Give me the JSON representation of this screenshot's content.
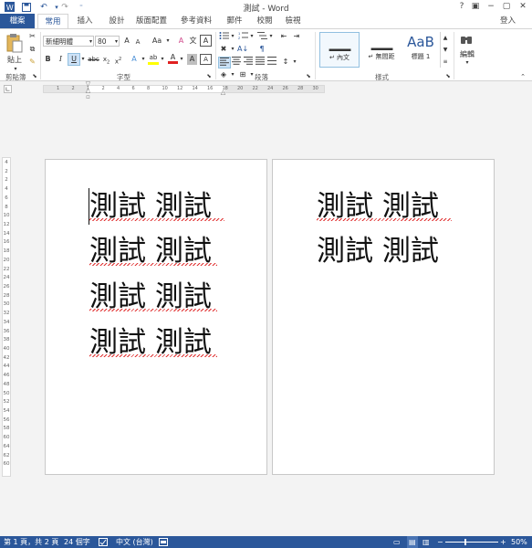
{
  "app": {
    "title": "測試 - Word",
    "login": "登入",
    "window_buttons": [
      "?",
      "▣",
      "−",
      "▢",
      "✕"
    ]
  },
  "tabs": [
    "檔案",
    "常用",
    "插入",
    "設計",
    "版面配置",
    "參考資料",
    "郵件",
    "校閱",
    "檢視"
  ],
  "ribbon": {
    "clipboard": {
      "paste_label": "貼上",
      "group_label": "剪貼簿"
    },
    "font": {
      "font_name": "新細明體",
      "font_size": "80",
      "grow": "A",
      "shrink": "A",
      "change_case": "Aa",
      "bold": "B",
      "italic": "I",
      "underline": "U",
      "strike": "abc",
      "subscript": "x",
      "superscript": "x",
      "text_effect": "A",
      "highlight": "ab",
      "font_color": "A",
      "char_shading": "A",
      "group_label": "字型"
    },
    "paragraph": {
      "group_label": "段落"
    },
    "styles": {
      "items": [
        {
          "preview": "▁▁",
          "label": "↵ 內文"
        },
        {
          "preview": "▁▁",
          "label": "↵ 無間距"
        },
        {
          "preview": "AaB",
          "label": "標題 1"
        }
      ],
      "group_label": "樣式"
    },
    "editing": {
      "label": "編輯"
    }
  },
  "document": {
    "page1_lines": [
      "測試 測試",
      "測試 測試",
      "測試 測試",
      "測試 測試"
    ],
    "page2_lines": [
      "測試 測試",
      "測試 測試"
    ]
  },
  "ruler": {
    "h_ticks": [
      "1",
      "2",
      "1",
      "2",
      "4",
      "6",
      "8",
      "10",
      "12",
      "14",
      "16",
      "18",
      "20",
      "22",
      "24",
      "26",
      "28",
      "30"
    ],
    "v_ticks": [
      "4",
      "2",
      "2",
      "4",
      "6",
      "8",
      "10",
      "12",
      "14",
      "16",
      "18",
      "20",
      "22",
      "24",
      "26",
      "28",
      "30",
      "32",
      "34",
      "36",
      "38",
      "40",
      "42",
      "44",
      "46",
      "48",
      "50",
      "52",
      "54",
      "56",
      "58",
      "60",
      "64",
      "62",
      "60"
    ]
  },
  "status": {
    "page": "第 1 頁，共 2 頁",
    "words": "24 個字",
    "language": "中文 (台灣)",
    "zoom": "50%"
  },
  "colors": {
    "accent": "#2b579a",
    "spell_error": "#e03030"
  }
}
